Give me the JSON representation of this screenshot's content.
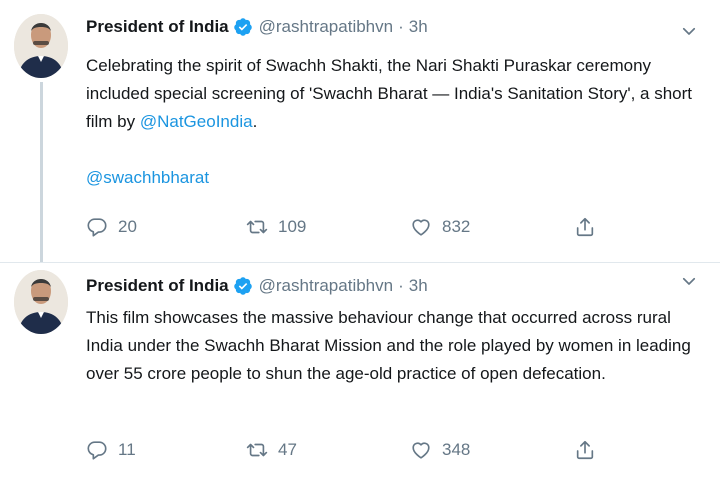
{
  "tweets": [
    {
      "author_name": "President of India",
      "handle": "@rashtrapatibhvn",
      "separator": "·",
      "time": "3h",
      "text_before": "Celebrating the spirit of Swachh Shakti, the Nari Shakti Puraskar ceremony included special screening of 'Swachh Bharat — India's Sanitation Story', a short film by ",
      "mention": "@NatGeoIndia",
      "text_after": ".",
      "hashtag_link": "@swachhbharat",
      "replies": "20",
      "retweets": "109",
      "likes": "832"
    },
    {
      "author_name": "President of India",
      "handle": "@rashtrapatibhvn",
      "separator": "·",
      "time": "3h",
      "text": "This film showcases the massive behaviour change that occurred across rural India under the Swachh Bharat Mission and the role played by women in leading over 55 crore people to shun the age-old practice of open defecation.",
      "replies": "11",
      "retweets": "47",
      "likes": "348"
    }
  ],
  "icons": {
    "verified": "verified-badge-icon",
    "more": "chevron-down-icon",
    "reply": "reply-icon",
    "retweet": "retweet-icon",
    "like": "heart-icon",
    "share": "share-icon"
  },
  "colors": {
    "link": "#1b95e0",
    "verified": "#1da1f2",
    "muted": "#657786",
    "thread_line": "#ccd6dd"
  }
}
